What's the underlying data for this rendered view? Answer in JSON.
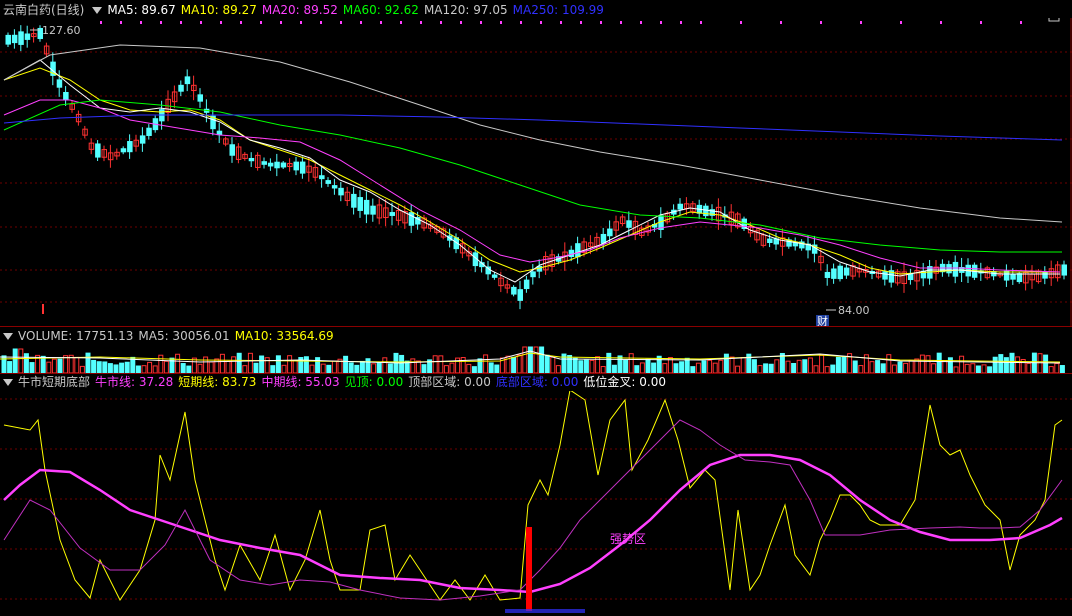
{
  "main": {
    "title": "云南白药(日线)",
    "ma": [
      {
        "label": "MA5: 89.67",
        "color": "#ffffff"
      },
      {
        "label": "MA10: 89.27",
        "color": "#ffff00"
      },
      {
        "label": "MA20: 89.52",
        "color": "#ff40ff"
      },
      {
        "label": "MA60: 92.62",
        "color": "#00ff00"
      },
      {
        "label": "MA120: 97.05",
        "color": "#c8c8c8"
      },
      {
        "label": "MA250: 109.99",
        "color": "#3030ff"
      }
    ],
    "high_label": "127.60",
    "low_label": "84.00",
    "marker_text": "财"
  },
  "volume": {
    "items": [
      {
        "label": "VOLUME: 17751.13",
        "color": "#c8c8c8"
      },
      {
        "label": "MA5: 30056.01",
        "color": "#c8c8c8"
      },
      {
        "label": "MA10: 33564.69",
        "color": "#ffff00"
      }
    ]
  },
  "indicator": {
    "name": "牛市短期底部",
    "items": [
      {
        "label": "牛市线: 37.28",
        "color": "#ff40ff"
      },
      {
        "label": "短期线: 83.73",
        "color": "#ffff00"
      },
      {
        "label": "中期线: 55.03",
        "color": "#ff40ff"
      },
      {
        "label": "见顶: 0.00",
        "color": "#00ff00"
      },
      {
        "label": "顶部区域: 0.00",
        "color": "#c8c8c8"
      },
      {
        "label": "底部区域: 0.00",
        "color": "#3030ff"
      },
      {
        "label": "低位金叉: 0.00",
        "color": "#ffffff"
      }
    ],
    "zone_label": "强势区"
  },
  "colors": {
    "up": "#ff3232",
    "down": "#54ffff",
    "grid": "#6e0000",
    "border": "#8a0000"
  },
  "chart_data": {
    "type": "line",
    "price_high": 127.6,
    "price_low": 84.0,
    "series": [
      {
        "name": "牛市线",
        "last": 37.28
      },
      {
        "name": "短期线",
        "last": 83.73
      },
      {
        "name": "中期线",
        "last": 55.03
      }
    ]
  }
}
